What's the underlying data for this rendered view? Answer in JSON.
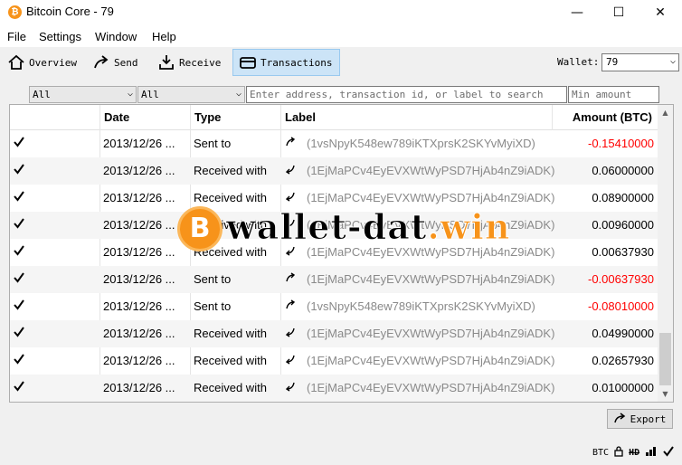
{
  "window": {
    "title": "Bitcoin Core - 79",
    "minimize": "—",
    "maximize": "☐",
    "close": "✕"
  },
  "menu": {
    "file": "File",
    "settings": "Settings",
    "window": "Window",
    "help": "Help"
  },
  "toolbar": {
    "overview": "Overview",
    "send": "Send",
    "receive": "Receive",
    "transactions": "Transactions",
    "wallet_label": "Wallet:",
    "wallet_value": "79"
  },
  "filters": {
    "date_value": "All",
    "type_value": "All",
    "search_placeholder": "Enter address, transaction id, or label to search",
    "min_amount_placeholder": "Min amount"
  },
  "table": {
    "headers": {
      "date": "Date",
      "type": "Type",
      "label": "Label",
      "amount": "Amount (BTC)"
    },
    "rows": [
      {
        "date": "2013/12/26 ...",
        "type": "Sent to",
        "label": "(1vsNpyK548ew789iKTXprsK2SKYvMyiXD)",
        "amount": "-0.15410000",
        "direction": "out"
      },
      {
        "date": "2013/12/26 ...",
        "type": "Received with",
        "label": "(1EjMaPCv4EyEVXWtWyPSD7HjAb4nZ9iADK)",
        "amount": "0.06000000",
        "direction": "in"
      },
      {
        "date": "2013/12/26 ...",
        "type": "Received with",
        "label": "(1EjMaPCv4EyEVXWtWyPSD7HjAb4nZ9iADK)",
        "amount": "0.08900000",
        "direction": "in"
      },
      {
        "date": "2013/12/26 ...",
        "type": "Received with",
        "label": "(1EjMaPCv4EyEVXWtWyPSD7HjAb4nZ9iADK)",
        "amount": "0.00960000",
        "direction": "in"
      },
      {
        "date": "2013/12/26 ...",
        "type": "Received with",
        "label": "(1EjMaPCv4EyEVXWtWyPSD7HjAb4nZ9iADK)",
        "amount": "0.00637930",
        "direction": "in"
      },
      {
        "date": "2013/12/26 ...",
        "type": "Sent to",
        "label": "(1EjMaPCv4EyEVXWtWyPSD7HjAb4nZ9iADK)",
        "amount": "-0.00637930",
        "direction": "out"
      },
      {
        "date": "2013/12/26 ...",
        "type": "Sent to",
        "label": "(1vsNpyK548ew789iKTXprsK2SKYvMyiXD)",
        "amount": "-0.08010000",
        "direction": "out"
      },
      {
        "date": "2013/12/26 ...",
        "type": "Received with",
        "label": "(1EjMaPCv4EyEVXWtWyPSD7HjAb4nZ9iADK)",
        "amount": "0.04990000",
        "direction": "in"
      },
      {
        "date": "2013/12/26 ...",
        "type": "Received with",
        "label": "(1EjMaPCv4EyEVXWtWyPSD7HjAb4nZ9iADK)",
        "amount": "0.02657930",
        "direction": "in"
      },
      {
        "date": "2013/12/26 ...",
        "type": "Received with",
        "label": "(1EjMaPCv4EyEVXWtWyPSD7HjAb4nZ9iADK)",
        "amount": "0.01000000",
        "direction": "in"
      }
    ]
  },
  "export_label": "Export",
  "statusbar": {
    "unit": "BTC",
    "hd": "HD"
  },
  "watermark": {
    "coin": "B",
    "text_a": "wallet-dat",
    "text_b": ".win"
  },
  "icons": {
    "status": "check-icon",
    "sent": "sent-icon",
    "received": "received-icon"
  },
  "colors": {
    "negative": "#ff0000",
    "accent": "#f7931a",
    "active_tab": "#cce4f7"
  }
}
